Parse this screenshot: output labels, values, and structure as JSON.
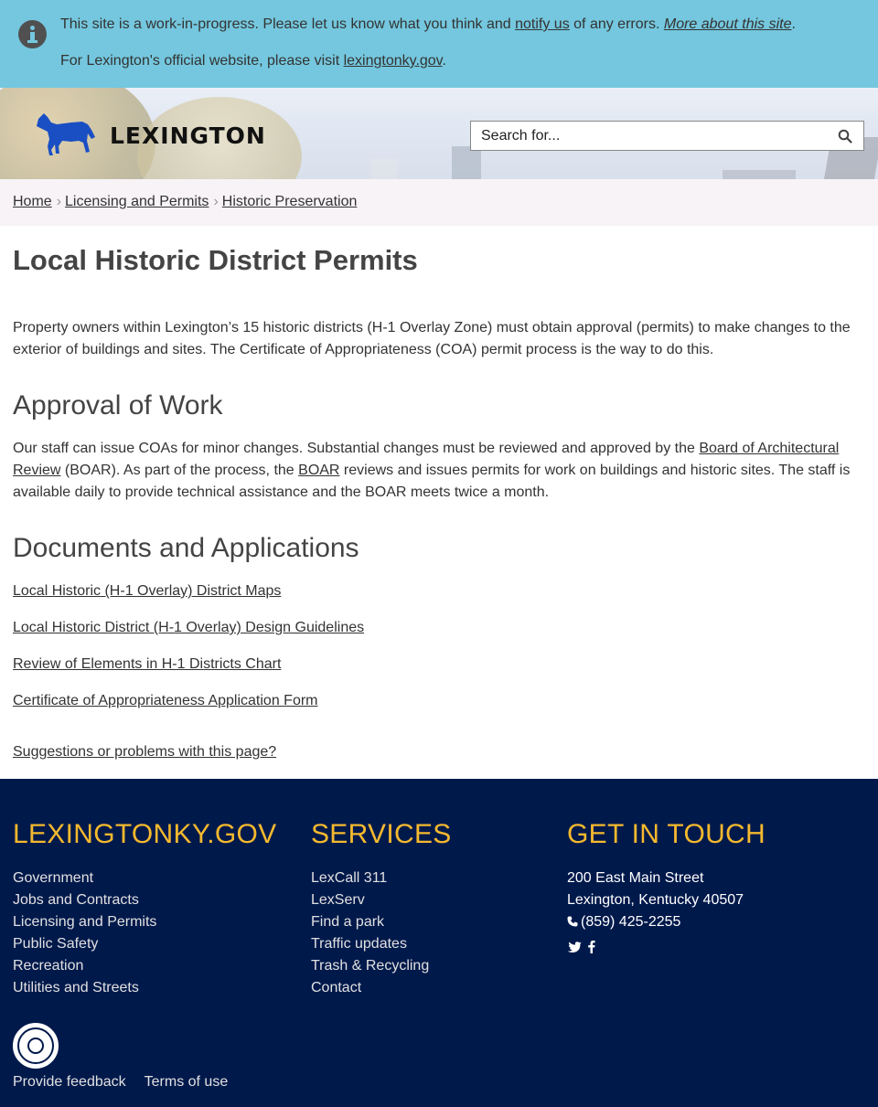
{
  "notice": {
    "line1_pre": "This site is a work-in-progress. Please let us know what you think and ",
    "notify_link": "notify us",
    "line1_mid": " of any errors. ",
    "more_link": "More about this site",
    "line1_post": ".",
    "line2_pre": "For Lexington's official website, please visit ",
    "official_link": "lexingtonky.gov",
    "line2_post": "."
  },
  "header": {
    "logo_text": "LEXINGTON",
    "search_placeholder": "Search for..."
  },
  "breadcrumb": {
    "items": [
      "Home",
      "Licensing and Permits",
      "Historic Preservation"
    ],
    "separator": "›"
  },
  "main": {
    "title": "Local Historic District Permits",
    "intro": "Property owners within Lexington’s 15 historic districts (H-1 Overlay Zone) must obtain approval (permits) to make changes to the exterior of buildings and sites. The Certificate of Appropriateness (COA) permit process is the way to do this.",
    "approval_heading": "Approval of Work",
    "approval_pre": "Our staff can issue COAs for minor changes. Substantial changes must be reviewed and approved by the ",
    "approval_link1": "Board of Architectural Review",
    "approval_mid": " (BOAR). As part of the process, the ",
    "approval_link2": "BOAR",
    "approval_post": " reviews and issues permits for work on buildings and historic sites. The staff is available daily to provide technical assistance and the BOAR meets twice a month.",
    "documents_heading": "Documents and Applications",
    "documents": [
      "Local Historic (H-1 Overlay) District Maps",
      "Local Historic District (H-1 Overlay) Design Guidelines",
      "Review of Elements in H-1 Districts Chart",
      "Certificate of Appropriateness Application Form"
    ],
    "feedback_link": "Suggestions or problems with this page?"
  },
  "footer": {
    "col1_heading": "LEXINGTONKY.GOV",
    "col1_links": [
      "Government",
      "Jobs and Contracts",
      "Licensing and Permits",
      "Public Safety",
      "Recreation",
      "Utilities and Streets"
    ],
    "col2_heading": "SERVICES",
    "col2_links": [
      "LexCall 311",
      "LexServ",
      "Find a park",
      "Traffic updates",
      "Trash & Recycling",
      "Contact"
    ],
    "col3_heading": "GET IN TOUCH",
    "address1": "200 East Main Street",
    "address2": "Lexington, Kentucky 40507",
    "phone": "(859) 425-2255",
    "bottom_links": [
      "Provide feedback",
      "Terms of use"
    ]
  },
  "colors": {
    "notice_bg": "#74c7de",
    "footer_bg": "#00194b",
    "footer_heading": "#f5b92e",
    "logo_horse": "#1a4fc4"
  },
  "icons": [
    "info-icon",
    "horse-logo-icon",
    "search-icon",
    "phone-icon",
    "twitter-icon",
    "facebook-icon",
    "city-seal-icon"
  ]
}
